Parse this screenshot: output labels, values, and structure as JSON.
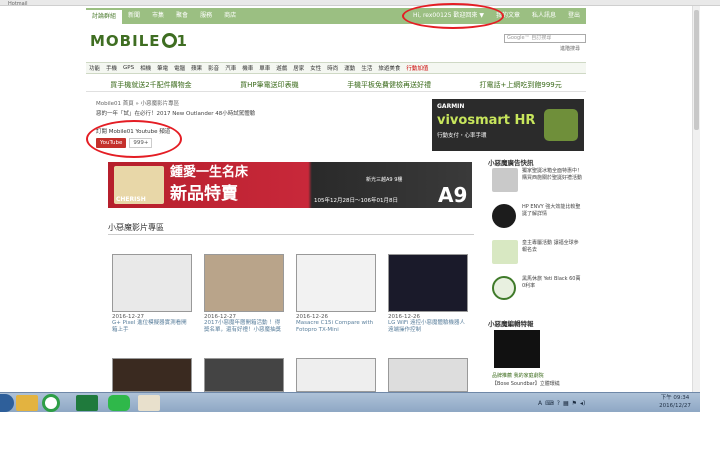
{
  "browser": {
    "strip_text": "Hotmail"
  },
  "topnav": [
    "討論群組",
    "新聞",
    "市集",
    "聚會",
    "服務",
    "商店"
  ],
  "userbar": {
    "greeting": "Hi, rex00125 歡迎回來 ▼",
    "my_articles": "我的文章",
    "messages": "私人訊息",
    "logout": "登出"
  },
  "logo": {
    "text": "MOBILE",
    "suffix": "1"
  },
  "search": {
    "placeholder": "Google™ 自訂搜尋",
    "advanced": "進階搜尋"
  },
  "categories": [
    "功能",
    "手機",
    "GPS",
    "相機",
    "筆電",
    "電腦",
    "蘋果",
    "影音",
    "汽車",
    "機車",
    "單車",
    "遊戲",
    "居家",
    "女性",
    "時尚",
    "運動",
    "生活",
    "旅遊美食",
    "行動加值"
  ],
  "promos": [
    "買手機就送2千配件購物金",
    "買HP筆電送印表機",
    "手機平板免費健檢再送好禮",
    "打電話+上網吃到飽999元"
  ],
  "breadcrumb": "Mobile01 首頁 » 小惡魔影片專區",
  "subline": "惡的一年「試」在必行！2017 New Outlander 48小時試駕體驗",
  "subscribe": {
    "label": "訂閱 Mobile01 Youtube 頻道",
    "button": "YouTube",
    "count": "999+"
  },
  "banner": {
    "brand": "CHERISH",
    "headline": "鍾愛一生名床",
    "sub": "新品特賣",
    "model": "新光三越A9 9樓",
    "date": "105年12月28日～106年01月8日",
    "tag": "A9"
  },
  "section_title": "小惡魔影片專區",
  "videos": [
    {
      "date": "2016-12-27",
      "title": "G+ Pixel 進位模擬器實測看開箱上手"
    },
    {
      "date": "2016-12-27",
      "title": "2017小惡魔年曆開箱活動 ！得獎名單，還有好禮！小惡魔抽獎"
    },
    {
      "date": "2016-12-26",
      "title": "Masacre C15i Compare with Fotopro TX-Mini"
    },
    {
      "date": "2016-12-26",
      "title": "LG WiFi 遠控小惡魔體驗機器人遠端操作控制"
    }
  ],
  "garmin": {
    "brand": "GARMIN",
    "product": "vivosmart HR",
    "tagline": "行動支付・心率手環"
  },
  "side": {
    "title1": "小惡魔廣告快訊",
    "items": [
      {
        "text": "獨家聖誕冰箱全面特惠中！購買西施關於聖誕好禮活動"
      },
      {
        "text": "HP ENVY 強大效能比較聖誕了解詳情"
      },
      {
        "text": "皇主專屬活動 讓福全球參 報名去"
      },
      {
        "text": "黑馬休旅 Yeti Black 60萬0利率"
      }
    ],
    "title2": "小惡魔編輯特報",
    "caption1": "【Bose Soundbar】立體環繞",
    "caption2": "品牌推薦 我的家庭劇院"
  },
  "taskbar": {
    "time": "下午 09:34",
    "date": "2016/12/27",
    "lang": "A"
  },
  "colors": {
    "brand_green": "#9bbf82",
    "logo_green": "#3f6e22",
    "annotation_red": "#e41d24"
  }
}
